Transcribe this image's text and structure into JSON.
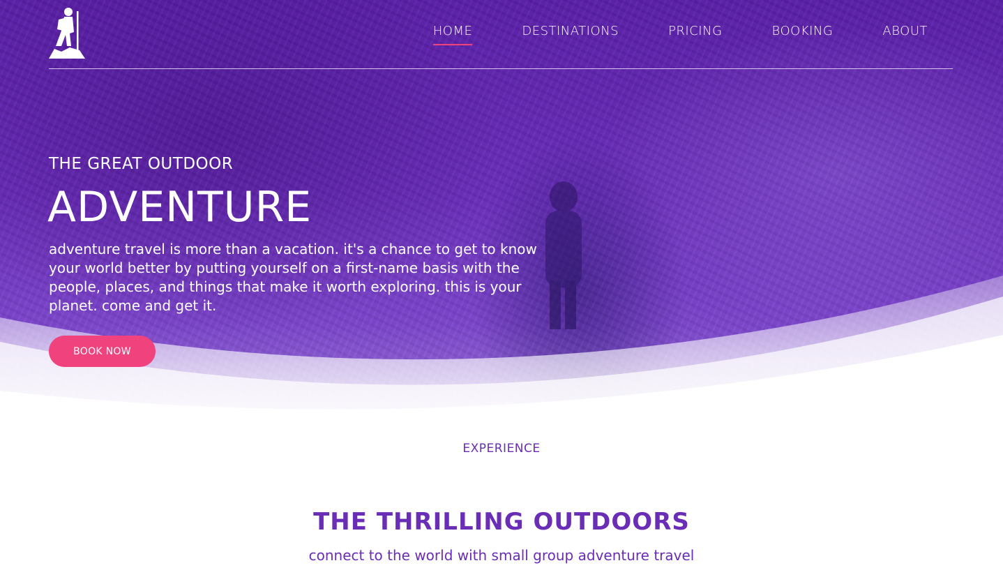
{
  "colors": {
    "brand_purple": "#6a2db5",
    "accent_pink": "#f0437d",
    "text_on_hero": "#ffffff"
  },
  "header": {
    "logo_icon": "hiker-logo-icon",
    "nav": [
      {
        "label": "HOME",
        "active": true
      },
      {
        "label": "DESTINATIONS",
        "active": false
      },
      {
        "label": "PRICING",
        "active": false
      },
      {
        "label": "BOOKING",
        "active": false
      },
      {
        "label": "ABOUT",
        "active": false
      }
    ]
  },
  "hero": {
    "eyebrow": "THE GREAT OUTDOOR",
    "headline": "ADVENTURE",
    "lead": "adventure travel is more than a vacation. it's a chance to get to know your world better by putting yourself on a first-name basis with the people, places, and things that make it worth exploring. this is your planet. come and get it.",
    "cta_label": "BOOK NOW"
  },
  "experience": {
    "kicker": "EXPERIENCE",
    "title": "THE THRILLING OUTDOORS",
    "subtitle": "connect to the world with small group adventure travel"
  }
}
